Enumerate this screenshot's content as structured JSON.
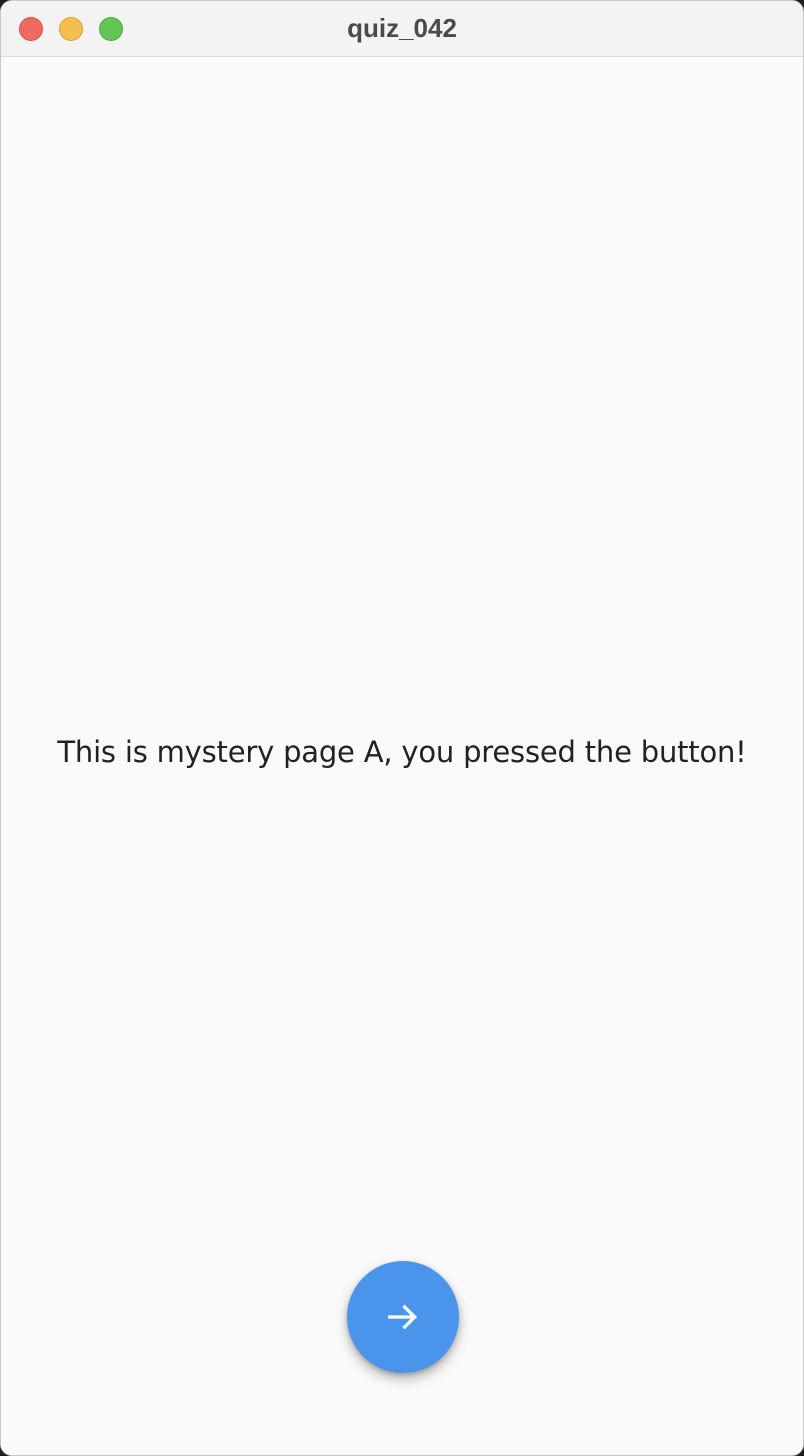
{
  "window": {
    "title": "quiz_042"
  },
  "page": {
    "message": "This is mystery page A, you pressed the button!"
  },
  "fab": {
    "icon": "arrow-forward-icon",
    "color": "#4a94ec"
  }
}
